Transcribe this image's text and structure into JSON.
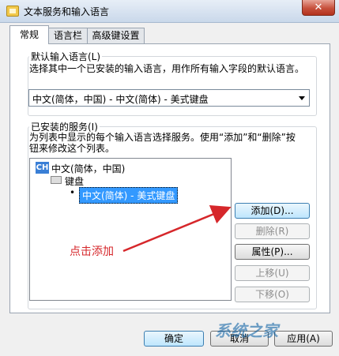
{
  "window": {
    "title": "文本服务和输入语言",
    "close_glyph": "✕"
  },
  "tabs": [
    {
      "label": "常规"
    },
    {
      "label": "语言栏"
    },
    {
      "label": "高级键设置"
    }
  ],
  "default_lang": {
    "group_title": "默认输入语言(L)",
    "description": "选择其中一个已安装的输入语言，用作所有输入字段的默认语言。",
    "selected": "中文(简体，中国) - 中文(简体) - 美式键盘"
  },
  "installed": {
    "group_title": "已安装的服务(I)",
    "description": "为列表中显示的每个输入语言选择服务。使用“添加”和“删除”按钮来修改这个列表。",
    "tree": {
      "badge": "CH",
      "language": "中文(简体，中国)",
      "category": "键盘",
      "service": "中文(简体) - 美式键盘"
    }
  },
  "side_buttons": {
    "add": "添加(D)...",
    "remove": "删除(R)",
    "properties": "属性(P)...",
    "move_up": "上移(U)",
    "move_down": "下移(O)"
  },
  "annotation": "点击添加",
  "footer": {
    "ok": "确定",
    "cancel": "取消",
    "apply": "应用(A)"
  },
  "watermark": "系统之家"
}
